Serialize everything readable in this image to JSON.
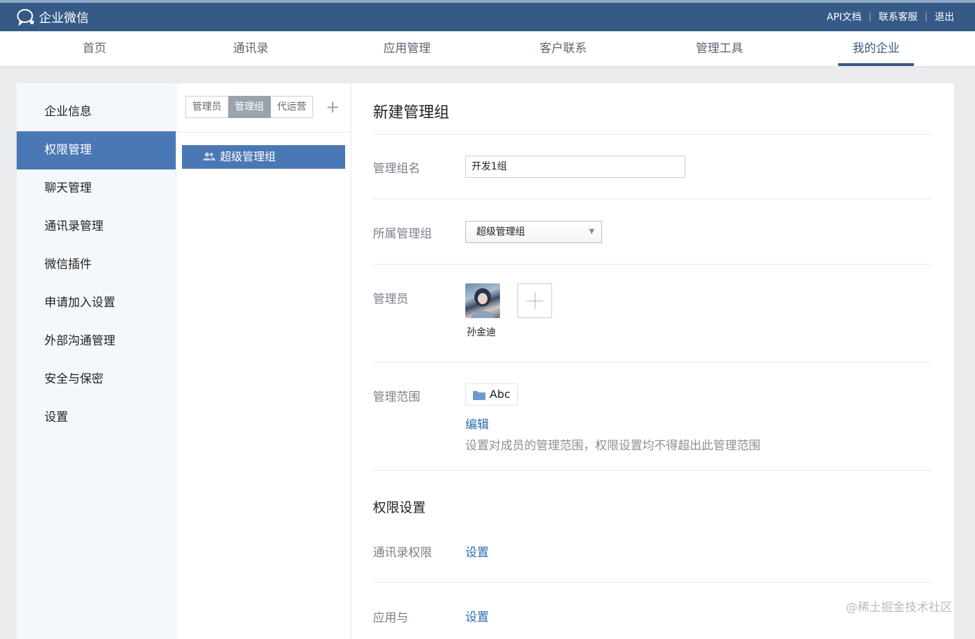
{
  "topbar": {
    "brand": "企业微信",
    "links": [
      "API文档",
      "联系客服",
      "退出"
    ]
  },
  "nav": {
    "items": [
      "首页",
      "通讯录",
      "应用管理",
      "客户联系",
      "管理工具",
      "我的企业"
    ],
    "active_index": 5
  },
  "sidebar": {
    "items": [
      "企业信息",
      "权限管理",
      "聊天管理",
      "通讯录管理",
      "微信插件",
      "申请加入设置",
      "外部沟通管理",
      "安全与保密",
      "设置"
    ],
    "active_index": 1
  },
  "middle": {
    "tabs": [
      "管理员",
      "管理组",
      "代运营"
    ],
    "active_tab_index": 1,
    "add_symbol": "+",
    "group_item": "超级管理组"
  },
  "form": {
    "title": "新建管理组",
    "group_name_label": "管理组名",
    "group_name_value": "开发1组",
    "parent_group_label": "所属管理组",
    "parent_group_value": "超级管理组",
    "admins_label": "管理员",
    "admin_name": "孙金迪",
    "scope_label": "管理范围",
    "scope_chip": "Abc",
    "edit_link": "编辑",
    "scope_help": "设置对成员的管理范围，权限设置均不得超出此管理范围",
    "perm_section_title": "权限设置",
    "contacts_perm_label": "通讯录权限",
    "contacts_perm_link": "设置",
    "apps_perm_label": "应用与",
    "apps_perm_link": "设置"
  },
  "watermark": "@稀土掘金技术社区",
  "colors": {
    "topbar": "#355a86",
    "accent": "#4a78b4",
    "link": "#2c6cb0"
  }
}
